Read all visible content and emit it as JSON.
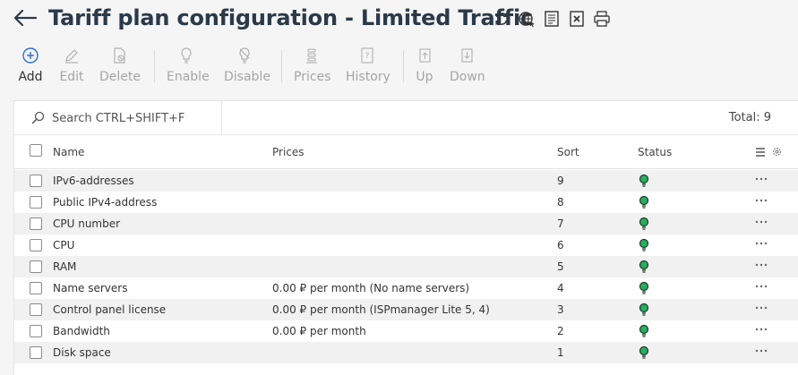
{
  "header": {
    "title": "Tariff plan configuration - Limited Traffic",
    "icons": [
      "refresh-icon",
      "globe-icon",
      "document-icon",
      "excel-export-icon",
      "print-icon"
    ]
  },
  "toolbar": {
    "add": "Add",
    "edit": "Edit",
    "delete": "Delete",
    "enable": "Enable",
    "disable": "Disable",
    "prices": "Prices",
    "history": "History",
    "up": "Up",
    "down": "Down"
  },
  "search": {
    "placeholder": "Search CTRL+SHIFT+F"
  },
  "total": "Total: 9",
  "table": {
    "columns": {
      "name": "Name",
      "prices": "Prices",
      "sort": "Sort",
      "status": "Status"
    },
    "rows": [
      {
        "name": "IPv6-addresses",
        "prices": "",
        "sort": "9",
        "status": "active"
      },
      {
        "name": "Public IPv4-address",
        "prices": "",
        "sort": "8",
        "status": "active"
      },
      {
        "name": "CPU number",
        "prices": "",
        "sort": "7",
        "status": "active"
      },
      {
        "name": "CPU",
        "prices": "",
        "sort": "6",
        "status": "active"
      },
      {
        "name": "RAM",
        "prices": "",
        "sort": "5",
        "status": "active"
      },
      {
        "name": "Name servers",
        "prices": "0.00 ₽ per month (No name servers)",
        "sort": "4",
        "status": "active"
      },
      {
        "name": "Control panel license",
        "prices": "0.00 ₽ per month (ISPmanager Lite 5, 4)",
        "sort": "3",
        "status": "active"
      },
      {
        "name": "Bandwidth",
        "prices": "0.00 ₽ per month",
        "sort": "2",
        "status": "active"
      },
      {
        "name": "Disk space",
        "prices": "",
        "sort": "1",
        "status": "active"
      }
    ]
  },
  "colors": {
    "accent": "#2a6fd6",
    "status_active": "#27ae60",
    "title": "#2b3a4a",
    "disabled": "#a5a5a5"
  }
}
